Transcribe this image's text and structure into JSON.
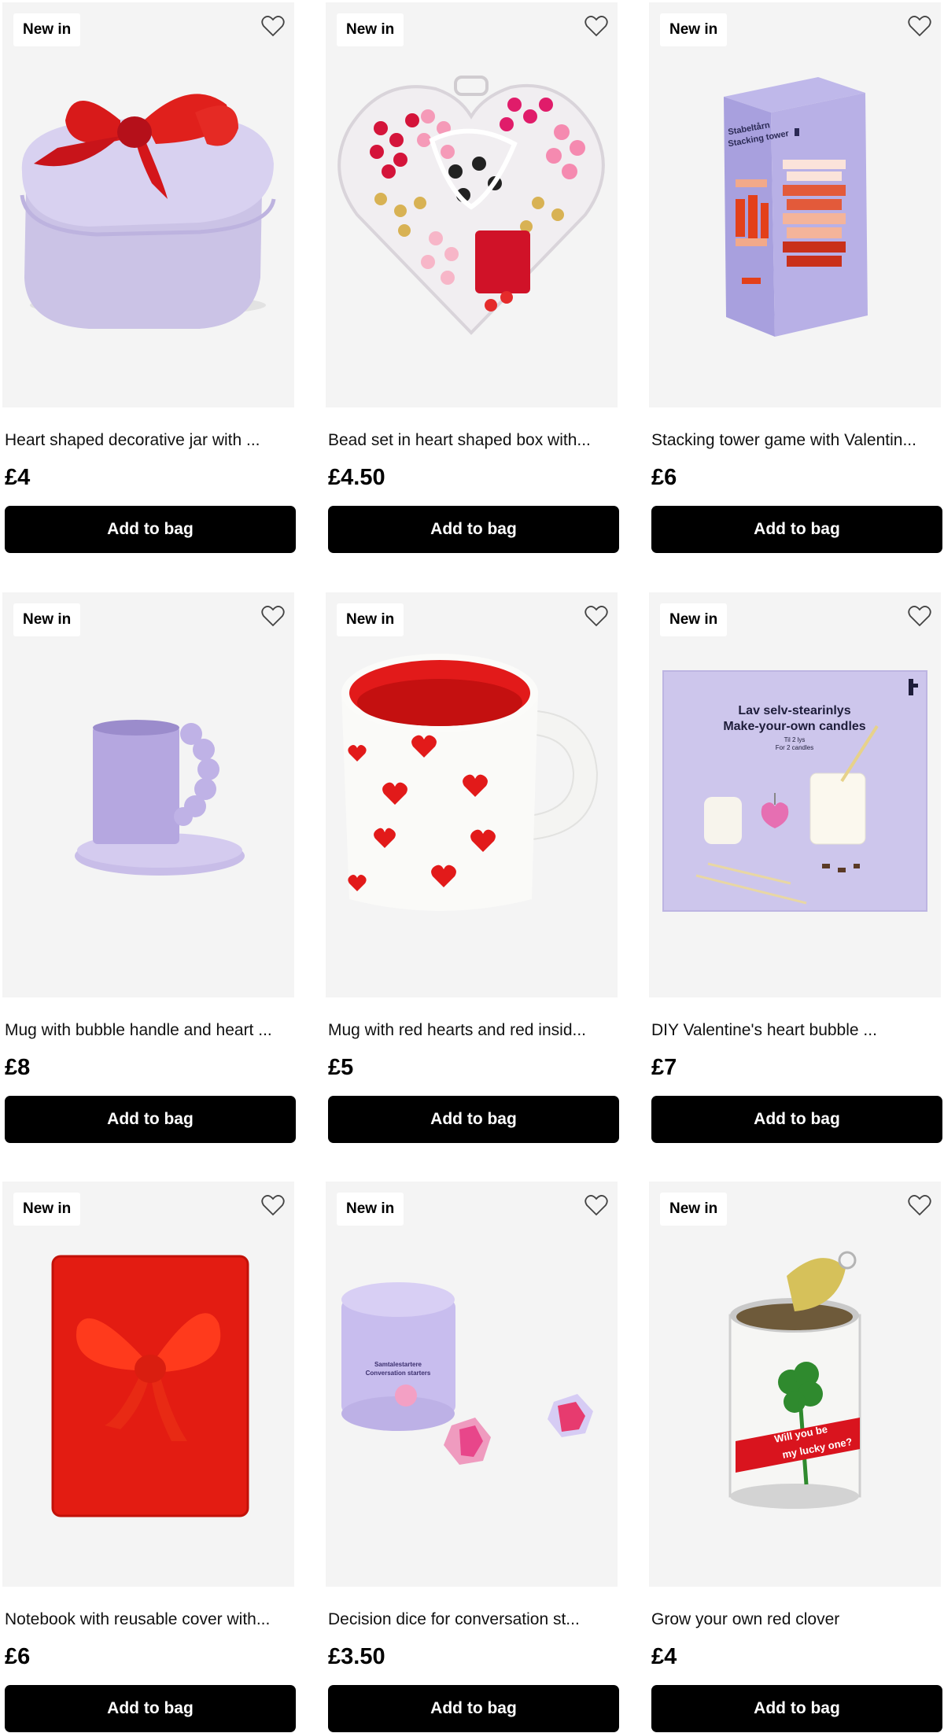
{
  "products": [
    {
      "badge": "New in",
      "title": "Heart shaped decorative jar with ...",
      "price": "£4",
      "button": "Add to bag",
      "art": "heart-jar"
    },
    {
      "badge": "New in",
      "title": "Bead set in heart shaped box with...",
      "price": "£4.50",
      "button": "Add to bag",
      "art": "bead-heart"
    },
    {
      "badge": "New in",
      "title": "Stacking tower game with Valentin...",
      "price": "£6",
      "button": "Add to bag",
      "art": "stacking-tower"
    },
    {
      "badge": "New in",
      "title": "Mug with bubble handle and heart ...",
      "price": "£8",
      "button": "Add to bag",
      "art": "bubble-mug"
    },
    {
      "badge": "New in",
      "title": "Mug with red hearts and red insid...",
      "price": "£5",
      "button": "Add to bag",
      "art": "hearts-mug"
    },
    {
      "badge": "New in",
      "title": "DIY Valentine's heart bubble ...",
      "price": "£7",
      "button": "Add to bag",
      "art": "candle-kit"
    },
    {
      "badge": "New in",
      "title": "Notebook with reusable cover with...",
      "price": "£6",
      "button": "Add to bag",
      "art": "notebook"
    },
    {
      "badge": "New in",
      "title": "Decision dice for conversation st...",
      "price": "£3.50",
      "button": "Add to bag",
      "art": "dice"
    },
    {
      "badge": "New in",
      "title": "Grow your own red clover",
      "price": "£4",
      "button": "Add to bag",
      "art": "clover-can"
    }
  ],
  "packaging_text": {
    "tower_box": [
      "Stabeltårn",
      "Stacking tower"
    ],
    "candle_box": [
      "Lav selv-stearinlys",
      "Make-your-own candles",
      "Til 2 lys",
      "For 2 candles"
    ],
    "dice_box": [
      "Samtalestartere",
      "Conversation starters"
    ],
    "clover_can": [
      "Will you be",
      "my lucky one?"
    ]
  },
  "colors": {
    "button_bg": "#000000",
    "button_text": "#ffffff",
    "tile_bg": "#f4f4f4",
    "accent_red": "#e0101c",
    "lilac": "#c9c2e8"
  }
}
